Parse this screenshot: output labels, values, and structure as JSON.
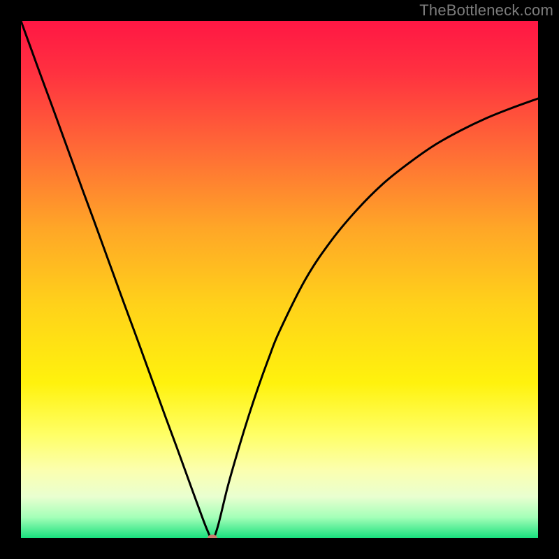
{
  "watermark": {
    "text": "TheBottleneck.com"
  },
  "chart_data": {
    "type": "line",
    "title": "",
    "xlabel": "",
    "ylabel": "",
    "xlim": [
      0,
      100
    ],
    "ylim": [
      0,
      100
    ],
    "x": [
      0,
      2,
      4,
      6,
      8,
      10,
      12,
      14,
      16,
      18,
      20,
      22,
      24,
      26,
      28,
      30,
      32,
      34,
      36,
      37,
      38,
      40,
      42,
      44,
      46,
      48,
      50,
      55,
      60,
      65,
      70,
      75,
      80,
      85,
      90,
      95,
      100
    ],
    "y": [
      100,
      94.5,
      89.0,
      83.6,
      78.1,
      72.6,
      67.1,
      61.7,
      56.2,
      50.7,
      45.2,
      39.8,
      34.3,
      28.8,
      23.3,
      17.9,
      12.4,
      6.9,
      1.6,
      0.0,
      2.0,
      10.0,
      17.0,
      23.5,
      29.5,
      35.0,
      40.0,
      50.0,
      57.5,
      63.5,
      68.5,
      72.5,
      76.0,
      78.8,
      81.2,
      83.2,
      85.0
    ],
    "marker": {
      "x": 37,
      "y": 0,
      "color": "#cc7b6e"
    },
    "background_gradient": {
      "stops": [
        {
          "pos": 0.0,
          "color": "#ff1744"
        },
        {
          "pos": 0.1,
          "color": "#ff3140"
        },
        {
          "pos": 0.25,
          "color": "#ff6b36"
        },
        {
          "pos": 0.4,
          "color": "#ffa627"
        },
        {
          "pos": 0.55,
          "color": "#ffd21a"
        },
        {
          "pos": 0.7,
          "color": "#fff20d"
        },
        {
          "pos": 0.8,
          "color": "#ffff66"
        },
        {
          "pos": 0.87,
          "color": "#fbffb0"
        },
        {
          "pos": 0.92,
          "color": "#e9ffd0"
        },
        {
          "pos": 0.96,
          "color": "#a4ffb8"
        },
        {
          "pos": 1.0,
          "color": "#18e07e"
        }
      ]
    }
  }
}
